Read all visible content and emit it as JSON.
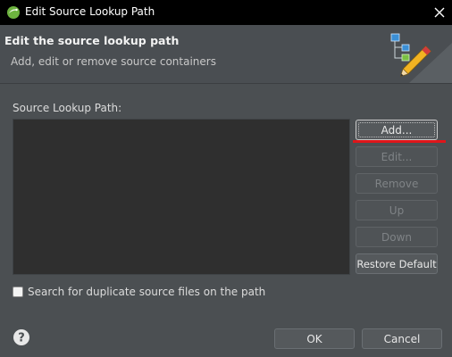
{
  "window": {
    "title": "Edit Source Lookup Path",
    "app_icon": "eclipse-icon",
    "close_icon": "close-icon"
  },
  "header": {
    "title": "Edit the source lookup path",
    "subtitle": "Add, edit or remove source containers",
    "art_icon": "pencil-tree-icon"
  },
  "list": {
    "label": "Source Lookup Path:"
  },
  "buttons": {
    "add": "Add...",
    "edit": "Edit...",
    "remove": "Remove",
    "up": "Up",
    "down": "Down",
    "restore_default": "Restore Default",
    "ok": "OK",
    "cancel": "Cancel"
  },
  "checkbox": {
    "label": "Search for duplicate source files on the path",
    "checked": false
  },
  "help_icon": "help-icon",
  "colors": {
    "titlebar": "#000000",
    "dialog_bg": "#4b4f52",
    "list_bg": "#2f2f2f",
    "highlight_underline": "#e0151a"
  }
}
